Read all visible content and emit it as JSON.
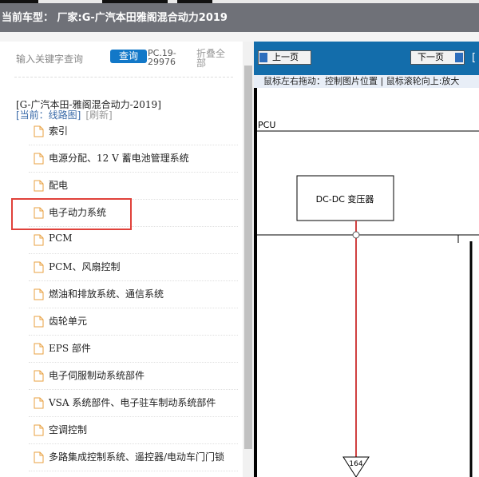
{
  "header": {
    "current_model_label": "当前车型：  厂家:G-广汽本田雅阁混合动力2019"
  },
  "left_panel": {
    "search_placeholder": "输入关键字查询",
    "search_button": "查询",
    "pc_code": "PC.19-29976",
    "collapse_all": "折叠全部",
    "model_title": "[G-广汽本田-雅阁混合动力-2019]",
    "current_label": "[当前：线路图]",
    "refresh_label": "[刷新]",
    "tree_items": [
      "索引",
      "电源分配、12 V 蓄电池管理系统",
      "配电",
      "电子动力系统",
      "PCM",
      "PCM、风扇控制",
      "燃油和排放系统、通信系统",
      "齿轮单元",
      "EPS 部件",
      "电子伺服制动系统部件",
      "VSA 系统部件、电子驻车制动系统部件",
      "空调控制",
      "多路集成控制系统、遥控器/电动车门门锁"
    ],
    "highlighted_item": "电子动力系统"
  },
  "viewer": {
    "prev_page": "上一页",
    "next_page": "下一页",
    "bracket": "[",
    "hint": "鼠标左右拖动：控制图片位置 | 鼠标滚轮向上:放大",
    "diagram": {
      "pcu_label": "PCU",
      "converter_label": "DC-DC 变压器",
      "connector_number": "164"
    }
  },
  "colors": {
    "header_bg": "#6f7178",
    "toolbar_bg": "#136dab",
    "search_button_bg": "#1278c8",
    "highlight_border": "#e0413a",
    "wire_red": "#d04040"
  }
}
